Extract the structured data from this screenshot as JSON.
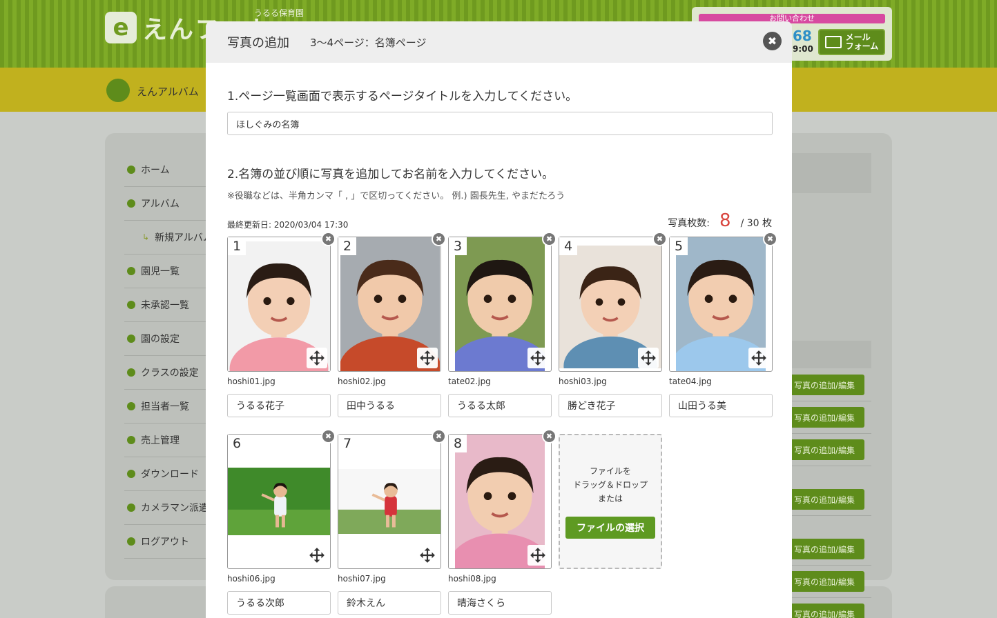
{
  "background": {
    "logo_mark": "e",
    "logo_text": "えんフォト",
    "school": "うるる保育園",
    "contact_title": "お問い合わせ",
    "phone_fragment": "68",
    "hours_fragment": "9:00",
    "mail_button": "メール\nフォーム",
    "band_text": "えんアルバム（",
    "menu": [
      {
        "label": "ホーム",
        "sub": false
      },
      {
        "label": "アルバム",
        "sub": false
      },
      {
        "label": "新規アルバム",
        "sub": true
      },
      {
        "label": "園児一覧",
        "sub": false
      },
      {
        "label": "未承認一覧",
        "sub": false
      },
      {
        "label": "園の設定",
        "sub": false
      },
      {
        "label": "クラスの設定",
        "sub": false
      },
      {
        "label": "担当者一覧",
        "sub": false
      },
      {
        "label": "売上管理",
        "sub": false
      },
      {
        "label": "ダウンロード",
        "sub": false
      },
      {
        "label": "カメラマン派遣",
        "sub": false
      },
      {
        "label": "ログアウト",
        "sub": false
      }
    ],
    "edit_button": "写真の追加/編集"
  },
  "modal": {
    "title": "写真の追加",
    "subtitle": "3〜4ページ：名簿ページ",
    "close": "✖",
    "q1": "1.ページ一覧画面で表示するページタイトルを入力してください。",
    "page_title_value": "ほしぐみの名簿",
    "q2": "2.名簿の並び順に写真を追加してお名前を入力してください。",
    "note": "※役職などは、半角カンマ「 , 」で区切ってください。 例.) 園長先生, やまだたろう",
    "updated": "最終更新日: 2020/03/04 17:30",
    "count_label": "写真枚数:",
    "count": "8",
    "count_max": "/ 30 枚",
    "photos": [
      {
        "num": "1",
        "file": "hoshi01.jpg",
        "name": "うるる花子"
      },
      {
        "num": "2",
        "file": "hoshi02.jpg",
        "name": "田中うるる"
      },
      {
        "num": "3",
        "file": "tate02.jpg",
        "name": "うるる太郎"
      },
      {
        "num": "4",
        "file": "hoshi03.jpg",
        "name": "勝どき花子"
      },
      {
        "num": "5",
        "file": "tate04.jpg",
        "name": "山田うる美"
      },
      {
        "num": "6",
        "file": "hoshi06.jpg",
        "name": "うるる次郎"
      },
      {
        "num": "7",
        "file": "hoshi07.jpg",
        "name": "鈴木えん"
      },
      {
        "num": "8",
        "file": "hoshi08.jpg",
        "name": "晴海さくら"
      }
    ],
    "drop_text": "ファイルを\nドラッグ＆ドロップ\nまたは",
    "select_button": "ファイルの選択"
  },
  "colors": {
    "accent": "#5e9a22",
    "count": "#d9463f",
    "header": "#6f9a1f",
    "band": "#c1b11e"
  }
}
